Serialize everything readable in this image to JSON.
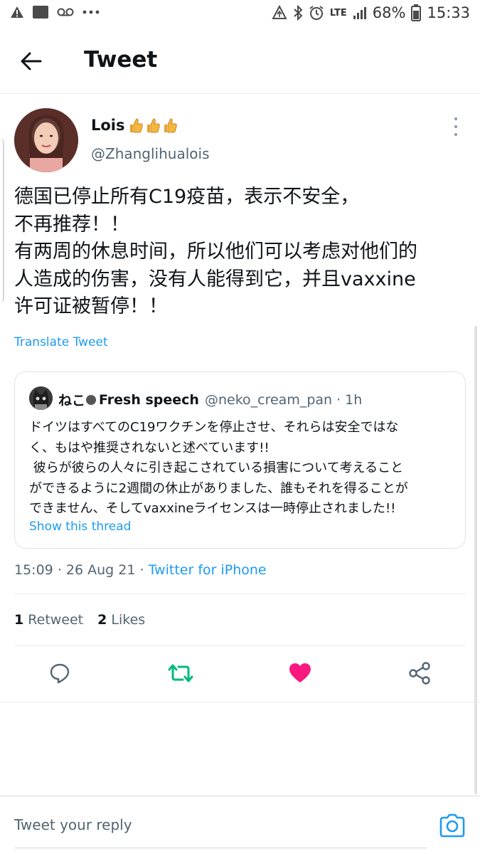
{
  "status_bar": {
    "network": "LTE",
    "battery": "68%",
    "time": "15:33",
    "icons": [
      "warning-icon",
      "gallery-icon",
      "voicemail-icon",
      "more-dots-icon",
      "data-saver-icon",
      "bluetooth-icon",
      "alarm-icon",
      "signal-icon",
      "battery-icon"
    ]
  },
  "header": {
    "title": "Tweet"
  },
  "tweet": {
    "author_name": "Lois",
    "author_emoji": "👍👍👍",
    "author_handle": "@Zhanglihualois",
    "text_lines": [
      "德国已停止所有C19疫苗，表示不安全，",
      "不再推荐！！",
      "有两周的休息时间，所以他们可以考虑对他们的",
      "人造成的伤害，没有人能得到它，并且vaxxine",
      "许可证被暂停！！"
    ],
    "translate_label": "Translate Tweet",
    "time": "15:09",
    "date": "26 Aug 21",
    "source": "Twitter for iPhone",
    "retweet_count": "1",
    "retweet_label": "Retweet",
    "like_count": "2",
    "like_label": "Likes"
  },
  "quoted": {
    "name_prefix": "ねこ",
    "name_suffix": "Fresh speech",
    "handle": "@neko_cream_pan",
    "age": "1h",
    "text_lines": [
      "ドイツはすべてのC19ワクチンを停止させ、それらは安全ではな",
      "く、もはや推奨されないと述べています!!",
      " 彼らが彼らの人々に引き起こされている損害について考えること",
      "ができるように2週間の休止がありました、誰もそれを得ることが",
      "できません、そしてvaxxineライセンスは一時停止されました!!"
    ],
    "show_thread_label": "Show this thread"
  },
  "reply": {
    "placeholder": "Tweet your reply"
  },
  "colors": {
    "accent": "#1d9bf0",
    "retweet_green": "#00ba7c",
    "like_pink": "#f91880",
    "text": "#0f1419",
    "secondary_text": "#536471"
  }
}
